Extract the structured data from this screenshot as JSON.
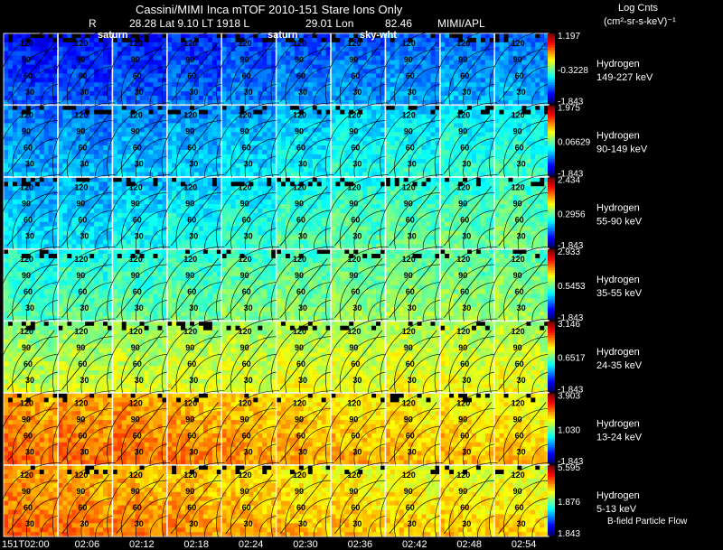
{
  "header": {
    "title": "Cassini/MIMI Inca mTOF  2010-151   Stare    Ions Only",
    "r_label": "R",
    "r_value": "28.28 Lat 9.10 LT 1918 L",
    "lt_value": "",
    "lon_value": "29.01 Lon",
    "alt_value": "82.46",
    "mimi_label": "MIMI/APL"
  },
  "colorbar": {
    "title": "Log Cnts",
    "units": "(cm²-sr-s-keV)⁻¹"
  },
  "footer_note": "B-field Particle Flow",
  "chart_data": {
    "type": "heatmap",
    "title": "Cassini/MIMI Inca mTOF  2010-151   Stare    Ions Only",
    "x_ticks": [
      "151T02:00",
      "02:06",
      "02:12",
      "02:18",
      "02:24",
      "02:30",
      "02:36",
      "02:42",
      "02:48",
      "02:54"
    ],
    "frame_overlay_labels": [
      "saturn",
      "saturn",
      "sky-wht"
    ],
    "contour_labels": [
      "120",
      "90",
      "60",
      "30"
    ],
    "rows": [
      {
        "species": "Hydrogen",
        "energy": "149-227 keV",
        "cmax": "1.197",
        "cmid": "-0.3228",
        "cmin": "-1.843",
        "level": [
          0.15,
          0.16,
          0.17,
          0.18,
          0.2,
          0.22,
          0.23,
          0.24,
          0.25,
          0.25
        ]
      },
      {
        "species": "Hydrogen",
        "energy": "90-149 keV",
        "cmax": "1.975",
        "cmid": "0.06629",
        "cmin": "-1.843",
        "level": [
          0.25,
          0.25,
          0.27,
          0.28,
          0.3,
          0.33,
          0.35,
          0.36,
          0.37,
          0.38
        ]
      },
      {
        "species": "Hydrogen",
        "energy": "55-90 keV",
        "cmax": "2.434",
        "cmid": "0.2956",
        "cmin": "-1.843",
        "level": [
          0.3,
          0.31,
          0.33,
          0.35,
          0.37,
          0.4,
          0.42,
          0.43,
          0.43,
          0.44
        ]
      },
      {
        "species": "Hydrogen",
        "energy": "35-55 keV",
        "cmax": "2.933",
        "cmid": "0.5453",
        "cmin": "-1.843",
        "level": [
          0.4,
          0.41,
          0.42,
          0.43,
          0.45,
          0.46,
          0.47,
          0.48,
          0.48,
          0.48
        ]
      },
      {
        "species": "Hydrogen",
        "energy": "24-35 keV",
        "cmax": "3.146",
        "cmid": "0.6517",
        "cmin": "-1.843",
        "level": [
          0.52,
          0.53,
          0.54,
          0.55,
          0.55,
          0.56,
          0.56,
          0.56,
          0.56,
          0.56
        ]
      },
      {
        "species": "Hydrogen",
        "energy": "13-24 keV",
        "cmax": "3.903",
        "cmid": "1.030",
        "cmin": "-1.843",
        "level": [
          0.72,
          0.72,
          0.72,
          0.7,
          0.68,
          0.66,
          0.65,
          0.64,
          0.64,
          0.63
        ]
      },
      {
        "species": "Hydrogen",
        "energy": "5-13 keV",
        "cmax": "5.595",
        "cmid": "1.876",
        "cmin": "1.843",
        "level": [
          0.72,
          0.71,
          0.7,
          0.68,
          0.66,
          0.64,
          0.63,
          0.62,
          0.62,
          0.61
        ]
      }
    ]
  }
}
